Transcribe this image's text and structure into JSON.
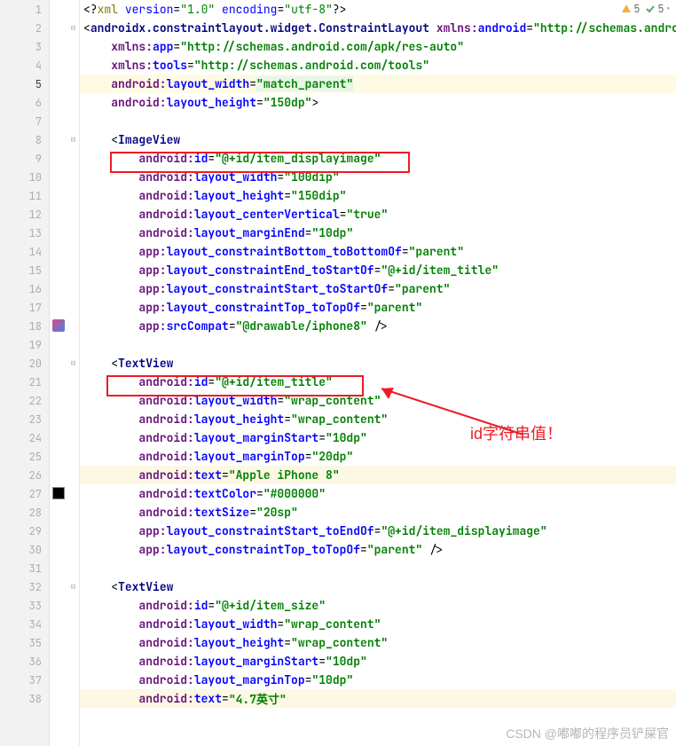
{
  "status": {
    "warn_count": "5",
    "ok_count": "5"
  },
  "annotation": "id字符串值！",
  "watermark": "CSDN @嘟嘟的程序员铲屎官",
  "lines": [
    {
      "n": "1",
      "indent": 0,
      "fold": "",
      "tokens": [
        [
          "t-punc",
          "<?"
        ],
        [
          "t-pi",
          "xml "
        ],
        [
          "t-piattr",
          "version"
        ],
        [
          "t-punc",
          "="
        ],
        [
          "t-pival",
          "\"1.0\""
        ],
        [
          "t-piattr",
          " encoding"
        ],
        [
          "t-punc",
          "="
        ],
        [
          "t-pival",
          "\"utf-8\""
        ],
        [
          "t-punc",
          "?>"
        ]
      ]
    },
    {
      "n": "2",
      "indent": 0,
      "fold": "−",
      "tokens": [
        [
          "t-punc",
          "<"
        ],
        [
          "t-tag",
          "androidx.constraintlayout.widget.ConstraintLayout "
        ],
        [
          "t-ns",
          "xmlns:"
        ],
        [
          "t-attr",
          "android"
        ],
        [
          "t-punc",
          "="
        ],
        [
          "t-val",
          "\"http://schemas.androi"
        ]
      ]
    },
    {
      "n": "3",
      "indent": 1,
      "fold": "",
      "tokens": [
        [
          "t-ns",
          "xmlns:"
        ],
        [
          "t-attr",
          "app"
        ],
        [
          "t-punc",
          "="
        ],
        [
          "t-val",
          "\"http://schemas.android.com/apk/res-auto\""
        ]
      ]
    },
    {
      "n": "4",
      "indent": 1,
      "fold": "",
      "tokens": [
        [
          "t-ns",
          "xmlns:"
        ],
        [
          "t-attr",
          "tools"
        ],
        [
          "t-punc",
          "="
        ],
        [
          "t-val",
          "\"http://schemas.android.com/tools\""
        ]
      ]
    },
    {
      "n": "5",
      "indent": 1,
      "fold": "",
      "hl": true,
      "tokens": [
        [
          "t-ns",
          "android:"
        ],
        [
          "t-attr",
          "layout_width"
        ],
        [
          "t-punc",
          "="
        ],
        [
          "t-val hl-green",
          "\"match_parent\""
        ]
      ]
    },
    {
      "n": "6",
      "indent": 1,
      "fold": "",
      "tokens": [
        [
          "t-ns",
          "android:"
        ],
        [
          "t-attr",
          "layout_height"
        ],
        [
          "t-punc",
          "="
        ],
        [
          "t-val",
          "\"150dp\""
        ],
        [
          "t-punc",
          ">"
        ]
      ]
    },
    {
      "n": "7",
      "indent": 0,
      "fold": "",
      "tokens": []
    },
    {
      "n": "8",
      "indent": 1,
      "fold": "−",
      "tokens": [
        [
          "t-punc",
          "<"
        ],
        [
          "t-tag",
          "ImageView"
        ]
      ]
    },
    {
      "n": "9",
      "indent": 2,
      "fold": "",
      "tokens": [
        [
          "t-ns",
          "android:"
        ],
        [
          "t-attr",
          "id"
        ],
        [
          "t-punc",
          "="
        ],
        [
          "t-val",
          "\"@+id/item_displayimage\""
        ]
      ]
    },
    {
      "n": "10",
      "indent": 2,
      "fold": "",
      "tokens": [
        [
          "t-ns",
          "android:"
        ],
        [
          "t-attr",
          "layout_width"
        ],
        [
          "t-punc",
          "="
        ],
        [
          "t-val",
          "\"100dip\""
        ]
      ]
    },
    {
      "n": "11",
      "indent": 2,
      "fold": "",
      "tokens": [
        [
          "t-ns",
          "android:"
        ],
        [
          "t-attr",
          "layout_height"
        ],
        [
          "t-punc",
          "="
        ],
        [
          "t-val",
          "\"150dip\""
        ]
      ]
    },
    {
      "n": "12",
      "indent": 2,
      "fold": "",
      "tokens": [
        [
          "t-ns",
          "android:"
        ],
        [
          "t-attr",
          "layout_centerVertical"
        ],
        [
          "t-punc",
          "="
        ],
        [
          "t-val",
          "\"true\""
        ]
      ]
    },
    {
      "n": "13",
      "indent": 2,
      "fold": "",
      "tokens": [
        [
          "t-ns",
          "android:"
        ],
        [
          "t-attr",
          "layout_marginEnd"
        ],
        [
          "t-punc",
          "="
        ],
        [
          "t-val",
          "\"10dp\""
        ]
      ]
    },
    {
      "n": "14",
      "indent": 2,
      "fold": "",
      "tokens": [
        [
          "t-ns",
          "app:"
        ],
        [
          "t-attr",
          "layout_constraintBottom_toBottomOf"
        ],
        [
          "t-punc",
          "="
        ],
        [
          "t-val",
          "\"parent\""
        ]
      ]
    },
    {
      "n": "15",
      "indent": 2,
      "fold": "",
      "tokens": [
        [
          "t-ns",
          "app:"
        ],
        [
          "t-attr",
          "layout_constraintEnd_toStartOf"
        ],
        [
          "t-punc",
          "="
        ],
        [
          "t-val",
          "\"@+id/item_title\""
        ]
      ]
    },
    {
      "n": "16",
      "indent": 2,
      "fold": "",
      "tokens": [
        [
          "t-ns",
          "app:"
        ],
        [
          "t-attr",
          "layout_constraintStart_toStartOf"
        ],
        [
          "t-punc",
          "="
        ],
        [
          "t-val",
          "\"parent\""
        ]
      ]
    },
    {
      "n": "17",
      "indent": 2,
      "fold": "",
      "tokens": [
        [
          "t-ns",
          "app:"
        ],
        [
          "t-attr",
          "layout_constraintTop_toTopOf"
        ],
        [
          "t-punc",
          "="
        ],
        [
          "t-val",
          "\"parent\""
        ]
      ]
    },
    {
      "n": "18",
      "indent": 2,
      "fold": "",
      "icon": "img",
      "tokens": [
        [
          "t-ns",
          "app:"
        ],
        [
          "t-attr",
          "srcCompat"
        ],
        [
          "t-punc",
          "="
        ],
        [
          "t-val",
          "\"@drawable/iphone8\""
        ],
        [
          "t-punc",
          " />"
        ]
      ]
    },
    {
      "n": "19",
      "indent": 0,
      "fold": "",
      "tokens": []
    },
    {
      "n": "20",
      "indent": 1,
      "fold": "−",
      "tokens": [
        [
          "t-punc",
          "<"
        ],
        [
          "t-tag",
          "TextView"
        ]
      ]
    },
    {
      "n": "21",
      "indent": 2,
      "fold": "",
      "tokens": [
        [
          "t-ns",
          "android:"
        ],
        [
          "t-attr",
          "id"
        ],
        [
          "t-punc",
          "="
        ],
        [
          "t-val",
          "\"@+id/item_title\""
        ]
      ]
    },
    {
      "n": "22",
      "indent": 2,
      "fold": "",
      "tokens": [
        [
          "t-ns",
          "android:"
        ],
        [
          "t-attr",
          "layout_width"
        ],
        [
          "t-punc",
          "="
        ],
        [
          "t-val",
          "\"wrap_content\""
        ]
      ]
    },
    {
      "n": "23",
      "indent": 2,
      "fold": "",
      "tokens": [
        [
          "t-ns",
          "android:"
        ],
        [
          "t-attr",
          "layout_height"
        ],
        [
          "t-punc",
          "="
        ],
        [
          "t-val",
          "\"wrap_content\""
        ]
      ]
    },
    {
      "n": "24",
      "indent": 2,
      "fold": "",
      "tokens": [
        [
          "t-ns",
          "android:"
        ],
        [
          "t-attr",
          "layout_marginStart"
        ],
        [
          "t-punc",
          "="
        ],
        [
          "t-val",
          "\"10dp\""
        ]
      ]
    },
    {
      "n": "25",
      "indent": 2,
      "fold": "",
      "tokens": [
        [
          "t-ns",
          "android:"
        ],
        [
          "t-attr",
          "layout_marginTop"
        ],
        [
          "t-punc",
          "="
        ],
        [
          "t-val",
          "\"20dp\""
        ]
      ]
    },
    {
      "n": "26",
      "indent": 2,
      "fold": "",
      "hlsoft": true,
      "tokens": [
        [
          "t-ns",
          "android:"
        ],
        [
          "t-attr",
          "text"
        ],
        [
          "t-punc",
          "="
        ],
        [
          "t-val",
          "\"Apple iPhone 8\""
        ]
      ]
    },
    {
      "n": "27",
      "indent": 2,
      "fold": "",
      "icon": "color",
      "tokens": [
        [
          "t-ns",
          "android:"
        ],
        [
          "t-attr",
          "textColor"
        ],
        [
          "t-punc",
          "="
        ],
        [
          "t-val",
          "\"#000000\""
        ]
      ]
    },
    {
      "n": "28",
      "indent": 2,
      "fold": "",
      "tokens": [
        [
          "t-ns",
          "android:"
        ],
        [
          "t-attr",
          "textSize"
        ],
        [
          "t-punc",
          "="
        ],
        [
          "t-val",
          "\"20sp\""
        ]
      ]
    },
    {
      "n": "29",
      "indent": 2,
      "fold": "",
      "tokens": [
        [
          "t-ns",
          "app:"
        ],
        [
          "t-attr",
          "layout_constraintStart_toEndOf"
        ],
        [
          "t-punc",
          "="
        ],
        [
          "t-val",
          "\"@+id/item_displayimage\""
        ]
      ]
    },
    {
      "n": "30",
      "indent": 2,
      "fold": "",
      "tokens": [
        [
          "t-ns",
          "app:"
        ],
        [
          "t-attr",
          "layout_constraintTop_toTopOf"
        ],
        [
          "t-punc",
          "="
        ],
        [
          "t-val",
          "\"parent\""
        ],
        [
          "t-punc",
          " />"
        ]
      ]
    },
    {
      "n": "31",
      "indent": 0,
      "fold": "",
      "tokens": []
    },
    {
      "n": "32",
      "indent": 1,
      "fold": "−",
      "tokens": [
        [
          "t-punc",
          "<"
        ],
        [
          "t-tag",
          "TextView"
        ]
      ]
    },
    {
      "n": "33",
      "indent": 2,
      "fold": "",
      "tokens": [
        [
          "t-ns",
          "android:"
        ],
        [
          "t-attr",
          "id"
        ],
        [
          "t-punc",
          "="
        ],
        [
          "t-val",
          "\"@+id/item_size\""
        ]
      ]
    },
    {
      "n": "34",
      "indent": 2,
      "fold": "",
      "tokens": [
        [
          "t-ns",
          "android:"
        ],
        [
          "t-attr",
          "layout_width"
        ],
        [
          "t-punc",
          "="
        ],
        [
          "t-val",
          "\"wrap_content\""
        ]
      ]
    },
    {
      "n": "35",
      "indent": 2,
      "fold": "",
      "tokens": [
        [
          "t-ns",
          "android:"
        ],
        [
          "t-attr",
          "layout_height"
        ],
        [
          "t-punc",
          "="
        ],
        [
          "t-val",
          "\"wrap_content\""
        ]
      ]
    },
    {
      "n": "36",
      "indent": 2,
      "fold": "",
      "tokens": [
        [
          "t-ns",
          "android:"
        ],
        [
          "t-attr",
          "layout_marginStart"
        ],
        [
          "t-punc",
          "="
        ],
        [
          "t-val",
          "\"10dp\""
        ]
      ]
    },
    {
      "n": "37",
      "indent": 2,
      "fold": "",
      "tokens": [
        [
          "t-ns",
          "android:"
        ],
        [
          "t-attr",
          "layout_marginTop"
        ],
        [
          "t-punc",
          "="
        ],
        [
          "t-val",
          "\"10dp\""
        ]
      ]
    },
    {
      "n": "38",
      "indent": 2,
      "fold": "",
      "hlsoft": true,
      "tokens": [
        [
          "t-ns",
          "android:"
        ],
        [
          "t-attr",
          "text"
        ],
        [
          "t-punc",
          "="
        ],
        [
          "t-val",
          "\"4.7英寸\""
        ]
      ]
    }
  ]
}
